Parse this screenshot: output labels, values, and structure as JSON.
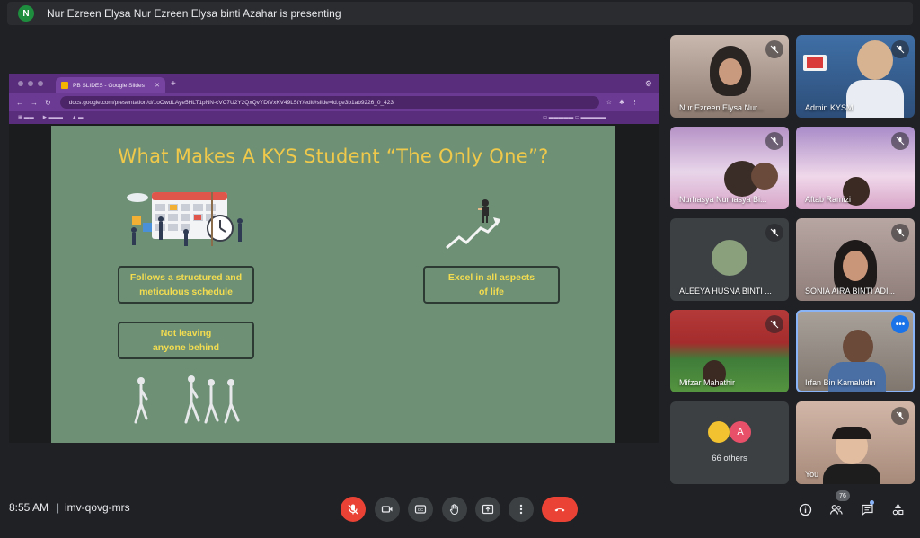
{
  "presenter": {
    "initial": "N",
    "text": "Nur Ezreen Elysa Nur Ezreen Elysa binti Azahar is presenting"
  },
  "browser": {
    "tab_title": "PB SLIDES - Google Slides",
    "url": "docs.google.com/presentation/d/1oOwdLAye5HLT1pNN-cVC7U2Y2QxQvYDfVxKV49L5tY/edit#slide=id.ge3b1ab9226_0_423"
  },
  "slide": {
    "title": "What Makes A KYS Student “The Only One”?",
    "box1_line1": "Follows a structured and",
    "box1_line2": "meticulous schedule",
    "box2_line1": "Excel in all aspects",
    "box2_line2": "of life",
    "box3_line1": "Not leaving",
    "box3_line2": "anyone behind"
  },
  "participants": [
    {
      "name": "Nur Ezreen Elysa Nur..."
    },
    {
      "name": "Admin KYSM"
    },
    {
      "name": "Nurhasya Nurhasya Bi..."
    },
    {
      "name": "Aftab Ramizi"
    },
    {
      "name": "ALEEYA HUSNA BINTI ..."
    },
    {
      "name": "SONIA AIRA BINTI ADI..."
    },
    {
      "name": "Mifzar Mahathir"
    },
    {
      "name": "Irfan Bin Kamaludin"
    },
    {
      "name": "You"
    }
  ],
  "others": {
    "label": "66 others",
    "avatar_letter": "A"
  },
  "meeting": {
    "time": "8:55 AM",
    "separator": "|",
    "code": "imv-qovg-mrs",
    "participant_count": "76"
  },
  "colors": {
    "end_call": "#ea4335",
    "slide_bg": "#6e9176",
    "slide_title": "#f0c94a",
    "active_tile_outline": "#8ab4f8"
  }
}
